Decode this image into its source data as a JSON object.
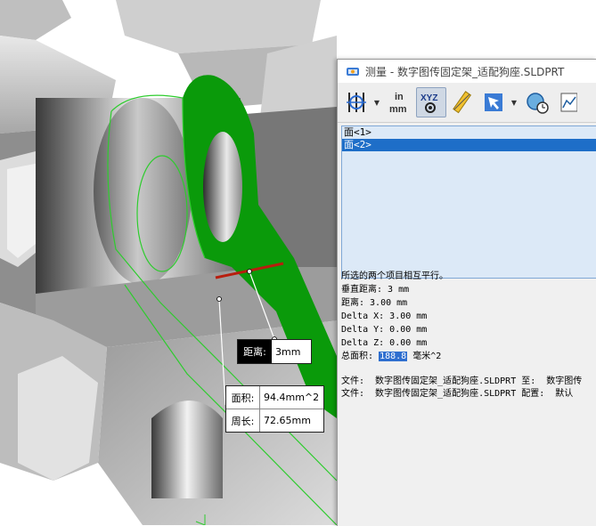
{
  "dialog": {
    "title": "测量 - 数字图传固定架_适配狗座.SLDPRT",
    "toolbar": [
      {
        "icon": "arc-circle-measure-icon"
      },
      {
        "icon": "units-in-mm-icon",
        "label_top": "in",
        "label_bottom": "mm"
      },
      {
        "icon": "show-xyz-icon",
        "label": "XYZ"
      },
      {
        "icon": "point-to-point-icon"
      },
      {
        "icon": "projection-arrow-icon"
      },
      {
        "icon": "measurement-history-icon"
      }
    ],
    "selection": [
      {
        "label": "面<1>",
        "selected": false
      },
      {
        "label": "面<2>",
        "selected": true
      }
    ],
    "results": {
      "line1": "所选的两个项目相互平行。",
      "line2": "垂直距离: 3 mm",
      "line3": "距离: 3.00 mm",
      "line4": "Delta X: 3.00 mm",
      "line5": "Delta Y: 0.00 mm",
      "line6": "Delta Z: 0.00 mm",
      "area_label": "总面积:",
      "area_value": "188.8",
      "area_unit": "毫米^2"
    },
    "file_info": {
      "line1": "文件:  数字图传固定架_适配狗座.SLDPRT 至:  数字图传",
      "line2": "文件:  数字图传固定架_适配狗座.SLDPRT 配置:  默认"
    }
  },
  "callouts": {
    "distance_label": "距离:",
    "distance_value": "3mm",
    "area_label": "面积:",
    "area_value": "94.4mm^2",
    "perimeter_label": "周长:",
    "perimeter_value": "72.65mm"
  },
  "colors": {
    "selected_face": "#0a9a0a",
    "measure_line": "#b81e0e",
    "edge_highlight": "#2ecc2e",
    "list_bg": "#dce9f7",
    "list_selected": "#1e6ec8"
  }
}
